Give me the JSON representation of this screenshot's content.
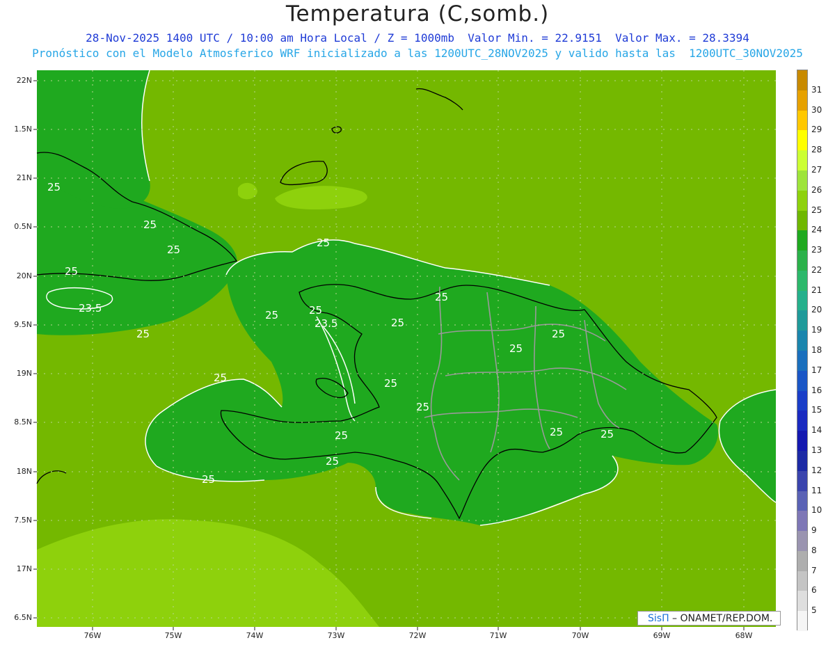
{
  "title": "Temperatura (C,somb.)",
  "subtitle_line1": "28-Nov-2025 1400 UTC / 10:00 am Hora Local / Z = 1000mb  Valor Min. = 22.9151  Valor Max. = 28.3394",
  "subtitle_line2": "Pronóstico con el Modelo Atmosferico WRF inicializado a las 1200UTC_28NOV2025 y valido hasta las  1200UTC_30NOV2025",
  "credit": {
    "brand": "SisΠ",
    "text": " – ONAMET/REP.DOM."
  },
  "lat_labels": [
    "22N",
    "1.5N",
    "21N",
    "0.5N",
    "20N",
    "9.5N",
    "19N",
    "8.5N",
    "18N",
    "7.5N",
    "17N",
    "6.5N"
  ],
  "lon_labels": [
    "76W",
    "75W",
    "74W",
    "73W",
    "72W",
    "71W",
    "70W",
    "69W",
    "68W"
  ],
  "colorbar": {
    "labels": [
      "31",
      "30",
      "29",
      "28",
      "27",
      "26",
      "25",
      "24",
      "23",
      "22",
      "21",
      "20",
      "19",
      "18",
      "17",
      "16",
      "15",
      "14",
      "13",
      "12",
      "11",
      "10",
      "9",
      "8",
      "7",
      "6",
      "5"
    ],
    "colors": [
      "#c88a00",
      "#e6a100",
      "#ffc800",
      "#ffff00",
      "#ccff33",
      "#9ee43a",
      "#8ed10c",
      "#6fb700",
      "#1fa91f",
      "#2bb14a",
      "#2cb86b",
      "#25b08c",
      "#1f9a9a",
      "#1a85ad",
      "#1a6fbd",
      "#1a56c6",
      "#1a3ec8",
      "#1a2ac0",
      "#1418b0",
      "#1c2aa5",
      "#3a44ad",
      "#5a62b5",
      "#7e77b6",
      "#9a94b0",
      "#aeaeae",
      "#c4c4c4",
      "#dedede",
      "#f5f5f5"
    ]
  },
  "contour_labels": [
    "25",
    "25",
    "25",
    "23.5",
    "25",
    "25",
    "25",
    "25",
    "23.5",
    "25",
    "25",
    "25",
    "25",
    "25",
    "25",
    "25",
    "25",
    "25",
    "25",
    "25",
    "25",
    "25"
  ],
  "colors": {
    "sea": "#74b800",
    "warm": "#8ed10c",
    "cool": "#1fa91f",
    "land_line": "#000000",
    "border_line": "#9a9a9a",
    "contour_line": "#ffffff"
  }
}
